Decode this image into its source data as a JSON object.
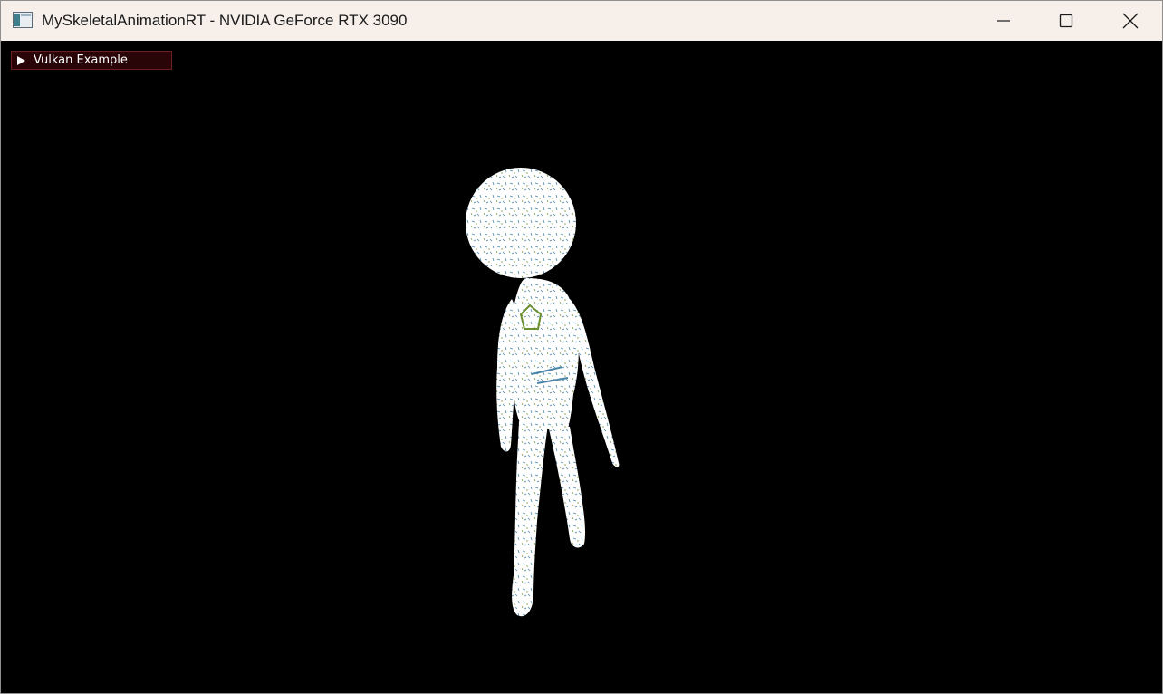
{
  "window": {
    "title": "MySkeletalAnimationRT - NVIDIA GeForce RTX 3090",
    "icon": "app-window-icon",
    "buttons": [
      "minimize-icon",
      "maximize-icon",
      "close-icon"
    ]
  },
  "imgui": {
    "header_label": "Vulkan Example",
    "expanded": false,
    "header_color": "#2a0508",
    "border_color": "#6e1e25"
  },
  "scene": {
    "background": "#000000",
    "model": "skeletal-figure",
    "model_color": "#ffffff",
    "texture_accent_colors": [
      "#4a86a8",
      "#6b8f2e",
      "#2f5f7a"
    ]
  }
}
